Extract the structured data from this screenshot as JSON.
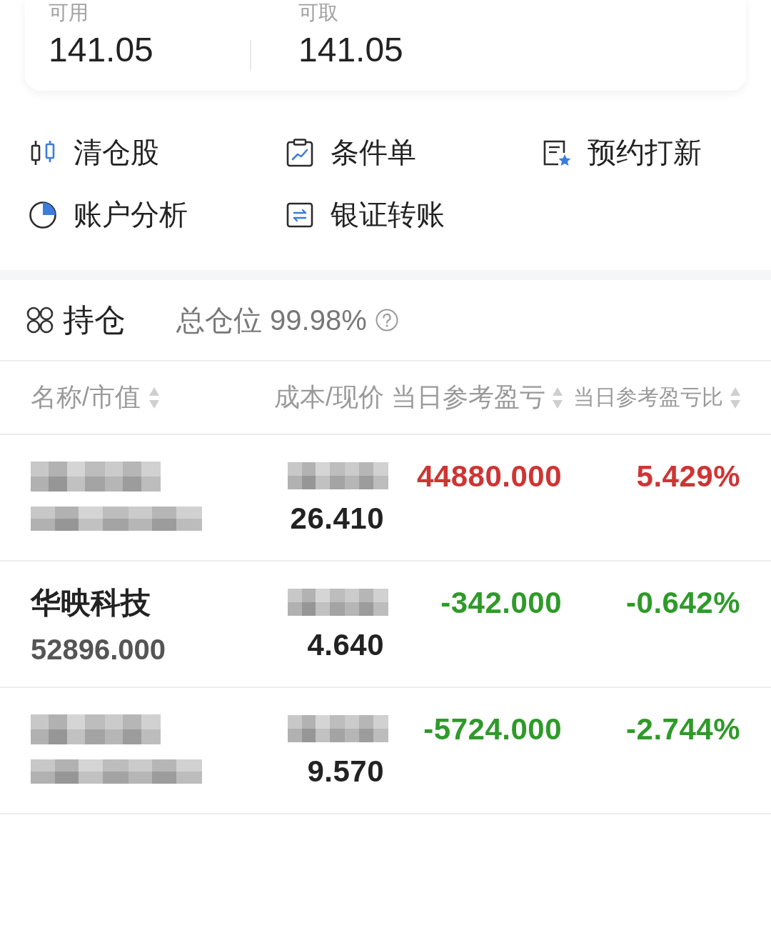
{
  "balances": [
    {
      "label": "可用",
      "value": "141.05"
    },
    {
      "label": "可取",
      "value": "141.05"
    }
  ],
  "shortcuts": [
    {
      "label": "清仓股"
    },
    {
      "label": "条件单"
    },
    {
      "label": "预约打新"
    },
    {
      "label": "账户分析"
    },
    {
      "label": "银证转账"
    }
  ],
  "holdings": {
    "title": "持仓",
    "position": "总仓位 99.98%"
  },
  "columns": [
    {
      "label": "名称/市值",
      "sortable": true
    },
    {
      "label": "成本/现价",
      "sortable": false
    },
    {
      "label": "当日参考盈亏",
      "sortable": true
    },
    {
      "label": "当日参考盈亏比",
      "sortable": true
    }
  ],
  "rows": [
    {
      "name": {
        "hidden": true
      },
      "market_value": {
        "hidden": true
      },
      "cost": {
        "hidden": true
      },
      "price": "26.410",
      "pnl": "44880.000",
      "pnl_pct": "5.429%",
      "color": "#cf3434"
    },
    {
      "name": {
        "hidden": false,
        "text": "华映科技"
      },
      "market_value": {
        "hidden": false,
        "text": "52896.000"
      },
      "cost": {
        "hidden": true
      },
      "price": "4.640",
      "pnl": "-342.000",
      "pnl_pct": "-0.642%",
      "color": "#2f9a2a"
    },
    {
      "name": {
        "hidden": true
      },
      "market_value": {
        "hidden": true
      },
      "cost": {
        "hidden": true
      },
      "price": "9.570",
      "pnl": "-5724.000",
      "pnl_pct": "-2.744%",
      "color": "#2f9a2a"
    }
  ]
}
